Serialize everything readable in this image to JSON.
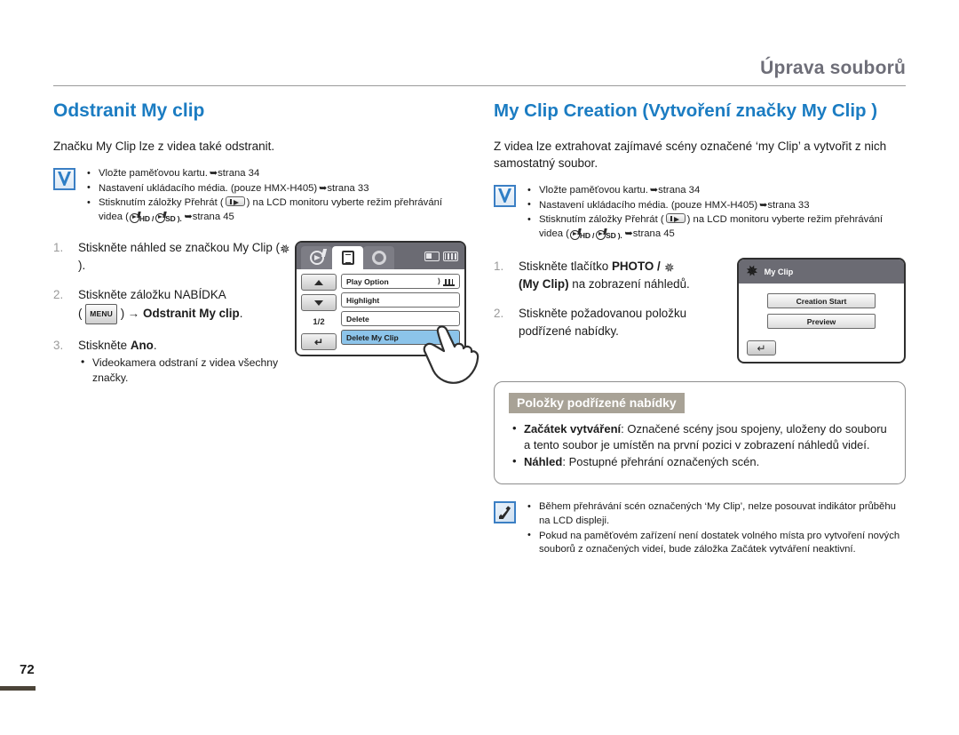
{
  "header": {
    "title": "Úprava souborů"
  },
  "page": {
    "number": "72"
  },
  "left": {
    "section_title": "Odstranit My clip",
    "intro": "Značku My Clip lze z videa také odstranit.",
    "prereq_icon": "checkmark-icon",
    "prereq": [
      {
        "pre": "Vložte paměťovou kartu.",
        "arrow": "➥",
        "post": "strana 34"
      },
      {
        "pre": "Nastavení ukládacího média. (pouze HMX-H405)",
        "arrow": "➥",
        "post": "strana 33"
      },
      {
        "pre": "Stisknutím záložky Přehrát (",
        "mid": ") na LCD monitoru vyberte režim přehrávání videa (",
        "mid2": "HD /",
        "mid3": "SD ).",
        "arrow": "➥",
        "post": "strana 45"
      }
    ],
    "steps": [
      {
        "num": "1.",
        "a": "Stiskněte náhled se značkou My Clip (",
        "b": ")."
      },
      {
        "num": "2.",
        "a": "Stiskněte záložku NABÍDKA",
        "menu_label": "MENU",
        "arrow": "→",
        "bold": "Odstranit My clip",
        "tail": "."
      },
      {
        "num": "3.",
        "a": "Stiskněte ",
        "bold": "Ano",
        "tail": ".",
        "sub": [
          "Videokamera odstraní z videa všechny značky."
        ]
      }
    ],
    "lcd": {
      "tabs": [
        "playback-mode-icon",
        "menu-list-icon",
        "settings-gear-icon"
      ],
      "status": [
        "card-icon",
        "battery-icon"
      ],
      "side_buttons": [
        "caret-up",
        "caret-down",
        "1/2",
        "back-arrow"
      ],
      "page_indicator": "1/2",
      "menu_items": [
        {
          "label": "Play Option",
          "has_right_icons": true,
          "active": false
        },
        {
          "label": "Highlight",
          "has_right_icons": false,
          "active": false
        },
        {
          "label": "Delete",
          "has_right_icons": false,
          "active": false
        },
        {
          "label": "Delete My Clip",
          "has_right_icons": false,
          "active": true
        }
      ]
    }
  },
  "right": {
    "section_title": "My Clip Creation (Vytvoření značky My Clip )",
    "intro": "Z videa lze extrahovat zajímavé scény označené ‘my Clip’ a vytvořit z nich samostatný soubor.",
    "prereq_icon": "checkmark-icon",
    "prereq": [
      {
        "pre": "Vložte paměťovou kartu.",
        "arrow": "➥",
        "post": "strana 34"
      },
      {
        "pre": "Nastavení ukládacího média. (pouze HMX-H405)",
        "arrow": "➥",
        "post": "strana 33"
      },
      {
        "pre": "Stisknutím záložky Přehrát (",
        "mid": ") na LCD monitoru vyberte režim přehrávání videa (",
        "mid2": "HD /",
        "mid3": "SD ).",
        "arrow": "➥",
        "post": "strana 45"
      }
    ],
    "steps": [
      {
        "num": "1.",
        "a": "Stiskněte tlačítko ",
        "bold": "PHOTO /",
        "b": "(My Clip)",
        "tail": " na zobrazení náhledů."
      },
      {
        "num": "2.",
        "a": "Stiskněte požadovanou položku podřízené nabídky."
      }
    ],
    "dialog": {
      "title": "My Clip",
      "title_icon": "my-clip-icon",
      "buttons": [
        "Creation Start",
        "Preview"
      ],
      "back_icon": "back-arrow-icon"
    },
    "callout": {
      "label": "Položky podřízené nabídky",
      "items": [
        {
          "bold": "Začátek vytváření",
          "text": ": Označené scény jsou spojeny, uloženy do souboru a tento soubor je umístěn na první pozici v zobrazení náhledů videí."
        },
        {
          "bold": "Náhled",
          "text": ": Postupné přehrání označených scén."
        }
      ]
    },
    "notes_icon": "note-pen-icon",
    "notes": [
      "Během přehrávání scén označených ‘My Clip’, nelze posouvat indikátor průběhu na LCD displeji.",
      "Pokud na paměťovém zařízení není dostatek volného místa pro vytvoření nových souborů z označených videí, bude záložka Začátek vytváření neaktivní."
    ]
  },
  "colors": {
    "heading_blue": "#1b7cc2",
    "header_gray": "#6e6e78",
    "label_taupe": "#a8a296",
    "menu_highlight": "#8cc4ea"
  }
}
